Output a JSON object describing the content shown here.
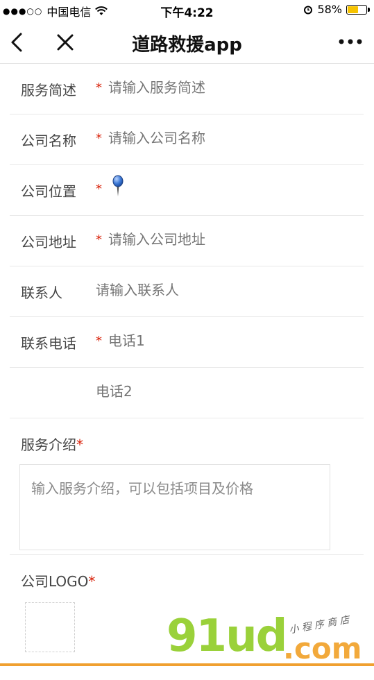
{
  "status_bar": {
    "signal": "●●●○○",
    "carrier": "中国电信",
    "time": "下午4:22",
    "battery": "58%",
    "battery_level": 0.58
  },
  "navbar": {
    "title": "道路救援app"
  },
  "form": {
    "rows": [
      {
        "label": "服务简述",
        "required": true,
        "placeholder": "请输入服务简述"
      },
      {
        "label": "公司名称",
        "required": true,
        "placeholder": "请输入公司名称"
      },
      {
        "label": "公司位置",
        "required": true
      },
      {
        "label": "公司地址",
        "required": true,
        "placeholder": "请输入公司地址"
      },
      {
        "label": "联系人",
        "required": false,
        "placeholder": "请输入联系人"
      },
      {
        "label": "联系电话",
        "required": true,
        "placeholder": "电话1"
      },
      {
        "label": "",
        "required": false,
        "placeholder": "电话2"
      }
    ],
    "required_mark": "*",
    "service_intro": {
      "label": "服务介绍",
      "placeholder": "输入服务介绍，可以包括项目及价格"
    },
    "company_logo": {
      "label": "公司LOGO"
    }
  },
  "watermark": {
    "brand": "91ud",
    "domain": ".com",
    "caption": "小 程 序 商 店"
  },
  "colors": {
    "required": "#d81e06",
    "battery": "#f6c300",
    "watermark_green": "#9ad13a",
    "watermark_orange": "#f2a93b"
  }
}
